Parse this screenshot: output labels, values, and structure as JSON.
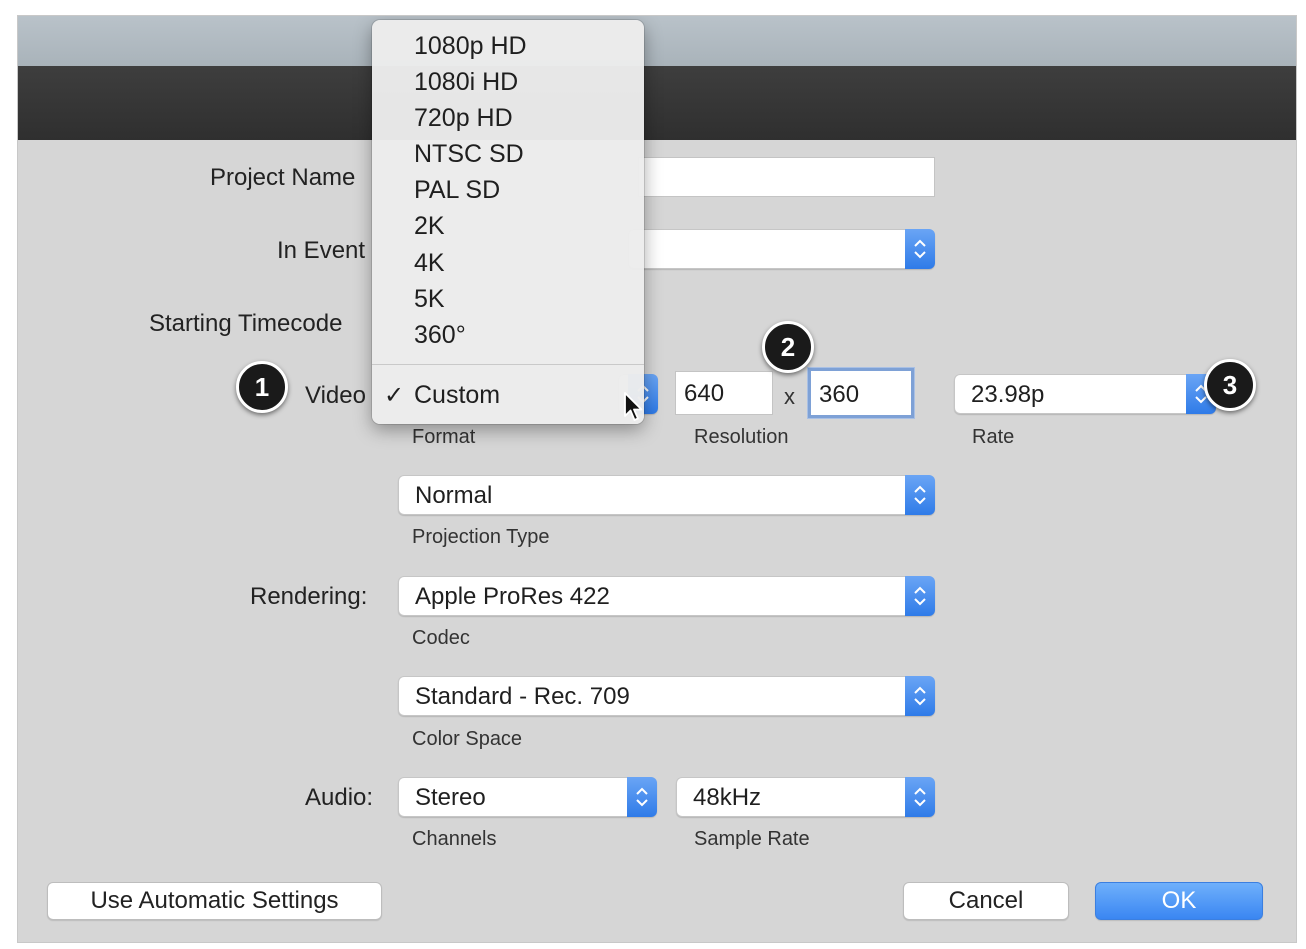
{
  "form": {
    "project_name_label": "Project Name",
    "in_event_label": "In Event",
    "starting_timecode_label": "Starting Timecode",
    "video_label": "Video",
    "rendering_label": "Rendering:",
    "audio_label": "Audio:"
  },
  "format_menu": {
    "items": [
      "1080p HD",
      "1080i HD",
      "720p HD",
      "NTSC SD",
      "PAL SD",
      "2K",
      "4K",
      "5K",
      "360°"
    ],
    "selected": "Custom",
    "check_glyph": "✓"
  },
  "video": {
    "format_caption": "Format",
    "resolution_width": "640",
    "resolution_separator": "x",
    "resolution_height": "360",
    "resolution_caption": "Resolution",
    "rate_value": "23.98p",
    "rate_caption": "Rate"
  },
  "projection": {
    "value": "Normal",
    "caption": "Projection Type"
  },
  "rendering": {
    "codec_value": "Apple ProRes 422",
    "codec_caption": "Codec",
    "color_space_value": "Standard - Rec. 709",
    "color_space_caption": "Color Space"
  },
  "audio": {
    "channels_value": "Stereo",
    "channels_caption": "Channels",
    "sample_rate_value": "48kHz",
    "sample_rate_caption": "Sample Rate"
  },
  "buttons": {
    "auto_settings": "Use Automatic Settings",
    "cancel": "Cancel",
    "ok": "OK"
  },
  "callouts": [
    "1",
    "2",
    "3"
  ],
  "colors": {
    "accent_blue": "#3a86f2",
    "badge": "#1a1a1a",
    "title_bar": "#333333"
  },
  "icons": {
    "stepper": "chevron-up-down-icon",
    "pointer": "mouse-pointer-icon",
    "checkmark": "checkmark-icon"
  }
}
